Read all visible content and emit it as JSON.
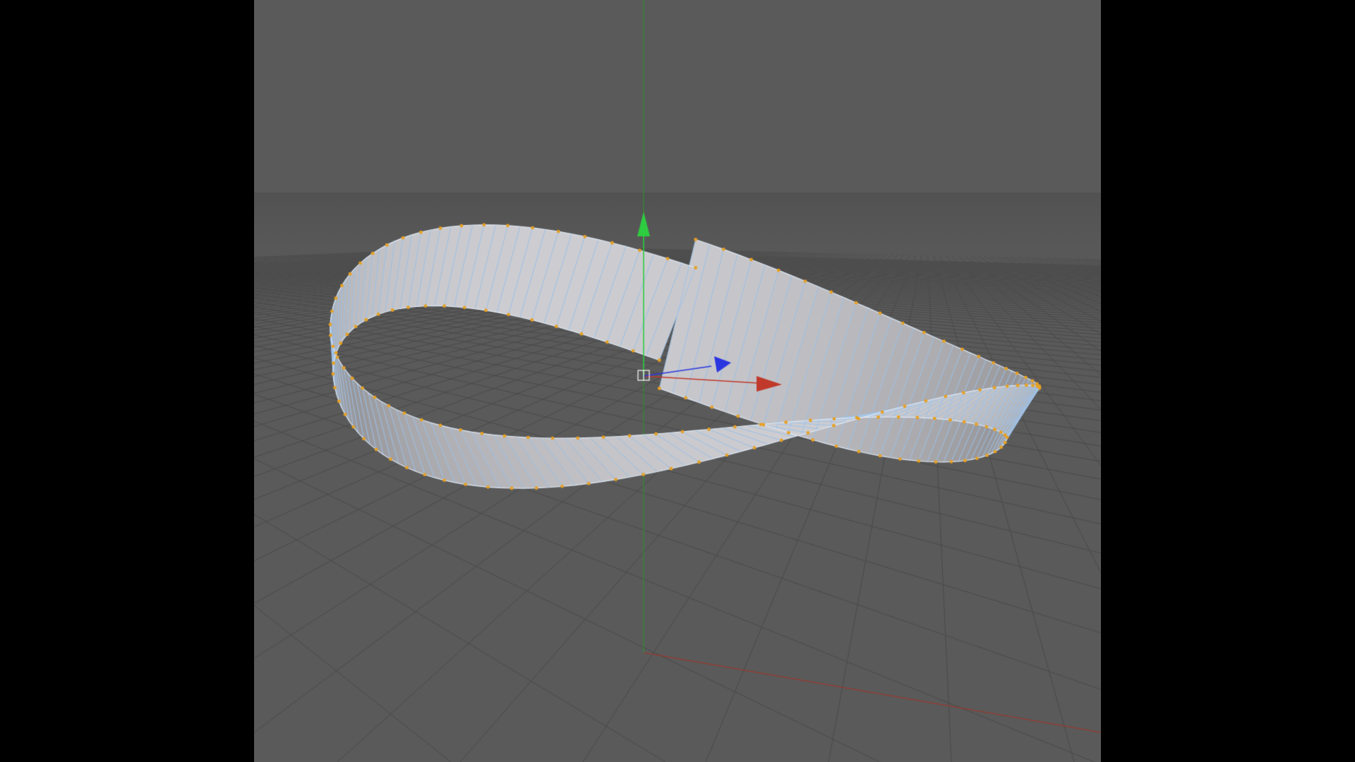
{
  "viewport": {
    "background_color": "#5a5a5a",
    "letterbox_color": "#000000",
    "horizon_line_color": "#8c8c8c",
    "grid_color": "#4a4a4a",
    "x_axis_color": "#a83226",
    "y_axis_color": "#2f8f2f"
  },
  "object": {
    "name": "mobius-strip",
    "surface_color": "#c9c9c9",
    "shadow_color": "#8d8d8d",
    "wire_color": "#9fc4ec",
    "point_color": "#e6a126",
    "selection_mode": "points"
  },
  "gizmo": {
    "x_color": "#c0392b",
    "y_color": "#2ecc40",
    "z_color": "#2a36e0",
    "pivot_color": "#ffffff"
  }
}
